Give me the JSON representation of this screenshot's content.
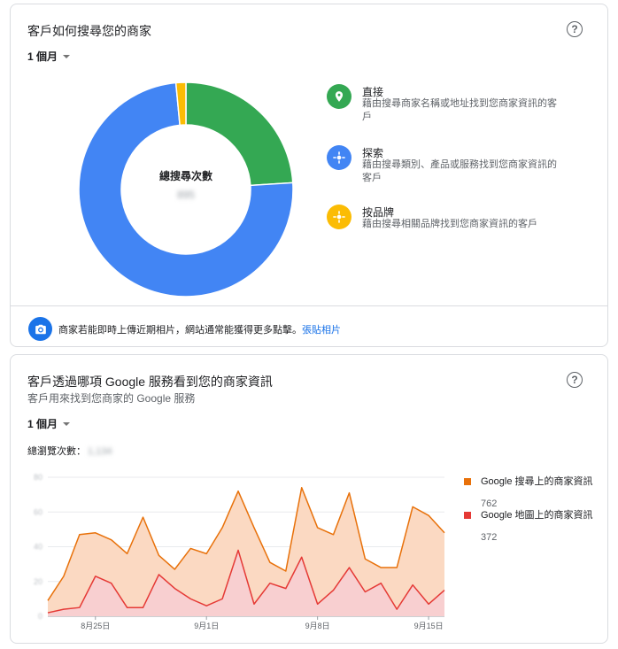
{
  "search_card": {
    "title": "客戶如何搜尋您的商家",
    "help_symbol": "?",
    "period": "1 個月",
    "donut": {
      "center_label": "總搜尋次數",
      "center_value": "895",
      "segments": [
        {
          "name": "直接",
          "share": 0.24,
          "color": "#34a853"
        },
        {
          "name": "探索",
          "share": 0.745,
          "color": "#4285f4"
        },
        {
          "name": "按品牌",
          "share": 0.015,
          "color": "#fbbc04"
        }
      ]
    },
    "legend": [
      {
        "title": "直接",
        "description": "藉由搜尋商家名稱或地址找到您商家資訊的客戶",
        "icon": "map-pin-icon",
        "color": "#34a853"
      },
      {
        "title": "探索",
        "description": "藉由搜尋類別、產品或服務找到您商家資訊的客戶",
        "icon": "compass-icon",
        "color": "#4285f4"
      },
      {
        "title": "按品牌",
        "description": "藉由搜尋相關品牌找到您商家資訊的客戶",
        "icon": "compass-icon",
        "color": "#fbbc04"
      }
    ],
    "footer": {
      "text": "商家若能即時上傳近期相片，網站通常能獲得更多點擊。",
      "link": "張貼相片"
    }
  },
  "views_card": {
    "title": "客戶透過哪項 Google 服務看到您的商家資訊",
    "subtitle": "客戶用來找到您商家的 Google 服務",
    "help_symbol": "?",
    "period": "1 個月",
    "total_label": "總瀏覽次數：",
    "total_value": "1,134",
    "series_legend": [
      {
        "name": "Google 搜尋上的商家資訊",
        "total": "762",
        "color": "#e8710a"
      },
      {
        "name": "Google 地圖上的商家資訊",
        "total": "372",
        "color": "#e53935"
      }
    ]
  },
  "chart_data": {
    "type": "area",
    "x": [
      "8/22",
      "8/23",
      "8/24",
      "8/25",
      "8/26",
      "8/27",
      "8/28",
      "8/29",
      "8/30",
      "8/31",
      "9/1",
      "9/2",
      "9/3",
      "9/4",
      "9/5",
      "9/6",
      "9/7",
      "9/8",
      "9/9",
      "9/10",
      "9/11",
      "9/12",
      "9/13",
      "9/14",
      "9/15",
      "9/16",
      "9/17",
      "9/18",
      "9/19",
      "9/20"
    ],
    "x_tick_labels": [
      {
        "x": "8/25",
        "label": "8月25日"
      },
      {
        "x": "9/1",
        "label": "9月1日"
      },
      {
        "x": "9/8",
        "label": "9月8日"
      },
      {
        "x": "9/15",
        "label": "9月15日"
      }
    ],
    "series": [
      {
        "name": "Google 搜尋上的商家資訊",
        "color": "#e8710a",
        "fill": "#fbd9c2",
        "values": [
          9,
          23,
          47,
          48,
          44,
          36,
          57,
          35,
          27,
          39,
          36,
          51,
          72,
          51,
          31,
          26,
          74,
          51,
          47,
          71,
          33,
          28,
          28,
          63,
          58,
          48
        ]
      },
      {
        "name": "Google 地圖上的商家資訊",
        "color": "#e53935",
        "fill": "#f8cfd1",
        "values": [
          2,
          4,
          5,
          23,
          19,
          5,
          5,
          24,
          16,
          10,
          6,
          10,
          38,
          7,
          19,
          16,
          34,
          7,
          15,
          28,
          14,
          19,
          4,
          18,
          7,
          15
        ]
      }
    ],
    "y_ticks": [
      "0",
      "20",
      "40",
      "60",
      "80"
    ],
    "ylim": [
      0,
      80
    ],
    "grid": true
  }
}
